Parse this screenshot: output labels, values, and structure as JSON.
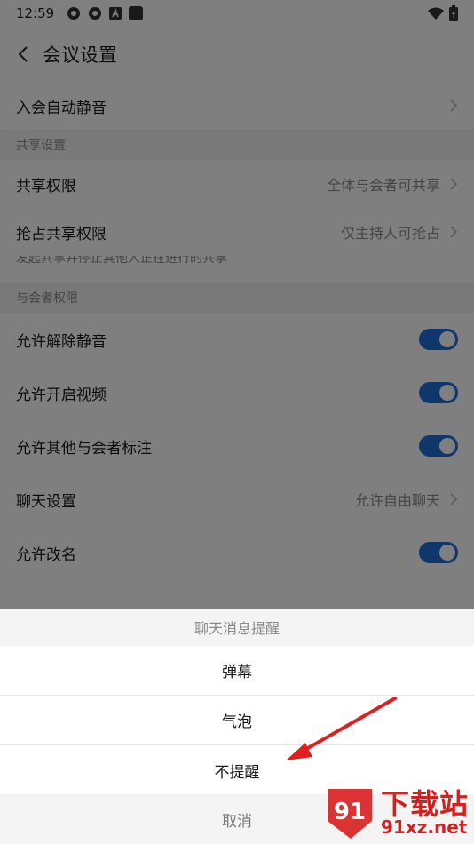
{
  "status_bar": {
    "time": "12:59"
  },
  "header": {
    "title": "会议设置"
  },
  "rows": {
    "auto_mute": {
      "label": "入会自动静音"
    },
    "share_section": "共享设置",
    "share_permission": {
      "label": "共享权限",
      "value": "全体与会者可共享"
    },
    "grab_share": {
      "label": "抢占共享权限",
      "value": "仅主持人可抢占",
      "description": "发起共享并停止其他人正在进行的共享"
    },
    "participant_section": "与会者权限",
    "allow_unmute": {
      "label": "允许解除静音",
      "enabled": true
    },
    "allow_video": {
      "label": "允许开启视频",
      "enabled": true
    },
    "allow_annotate": {
      "label": "允许其他与会者标注",
      "enabled": true
    },
    "chat_settings": {
      "label": "聊天设置",
      "value": "允许自由聊天"
    },
    "allow_rename": {
      "label": "允许改名",
      "enabled": true
    }
  },
  "sheet": {
    "title": "聊天消息提醒",
    "options": [
      "弹幕",
      "气泡",
      "不提醒"
    ],
    "cancel": "取消"
  },
  "colors": {
    "accent": "#1e6fd9",
    "arrow": "#e0201f",
    "watermark": "#d81e1e"
  },
  "watermark": {
    "brand": "下载站",
    "url": "91xz.net",
    "logo_text": "91"
  }
}
